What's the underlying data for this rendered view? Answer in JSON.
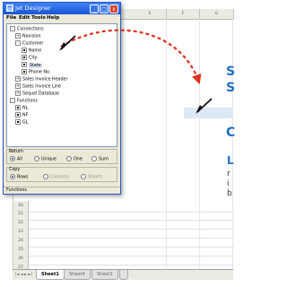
{
  "window": {
    "title": "Jet Designer",
    "menu": [
      "File",
      "Edit",
      "Tools",
      "Help"
    ],
    "buttons": {
      "minimize": "_",
      "maximize": "□",
      "close": "x"
    }
  },
  "tree": {
    "root": "Connections",
    "navision": "Navision",
    "customer": "Customer",
    "fields": [
      "Name",
      "City",
      "State",
      "Phone No."
    ],
    "other_tables": [
      "Sales Invoice Header",
      "Sales Invoice Line",
      "Sequel Database"
    ],
    "functions": "Functions",
    "function_items": [
      "NL",
      "NF",
      "GL"
    ]
  },
  "return_group": {
    "label": "Return",
    "options": [
      "All",
      "Unique",
      "One",
      "Sum"
    ],
    "selected": "All"
  },
  "copy_group": {
    "label": "Copy",
    "options": [
      "Rows",
      "Columns",
      "Sheets"
    ],
    "selected": "Rows"
  },
  "functions_bar": "Functions",
  "sheet": {
    "columns": [
      "E",
      "F",
      "G"
    ],
    "rows": [
      "20",
      "21",
      "22",
      "23",
      "24",
      "25",
      "26",
      "27"
    ],
    "tabs": [
      "Sheet1",
      "Sheet4",
      "Sheet1"
    ],
    "active_tab": "Sheet1",
    "nav_arrows": "|◄ ◄ ► ►|"
  },
  "side_text": {
    "s1": "S",
    "s2": "S",
    "c": "C",
    "l": "L",
    "lines": [
      "r",
      "i",
      "b"
    ]
  },
  "colors": {
    "accent": "#1e6fc0",
    "arrow": "#e0301e",
    "title_bar": "#1a55d3",
    "highlight": "#dde8f6"
  }
}
